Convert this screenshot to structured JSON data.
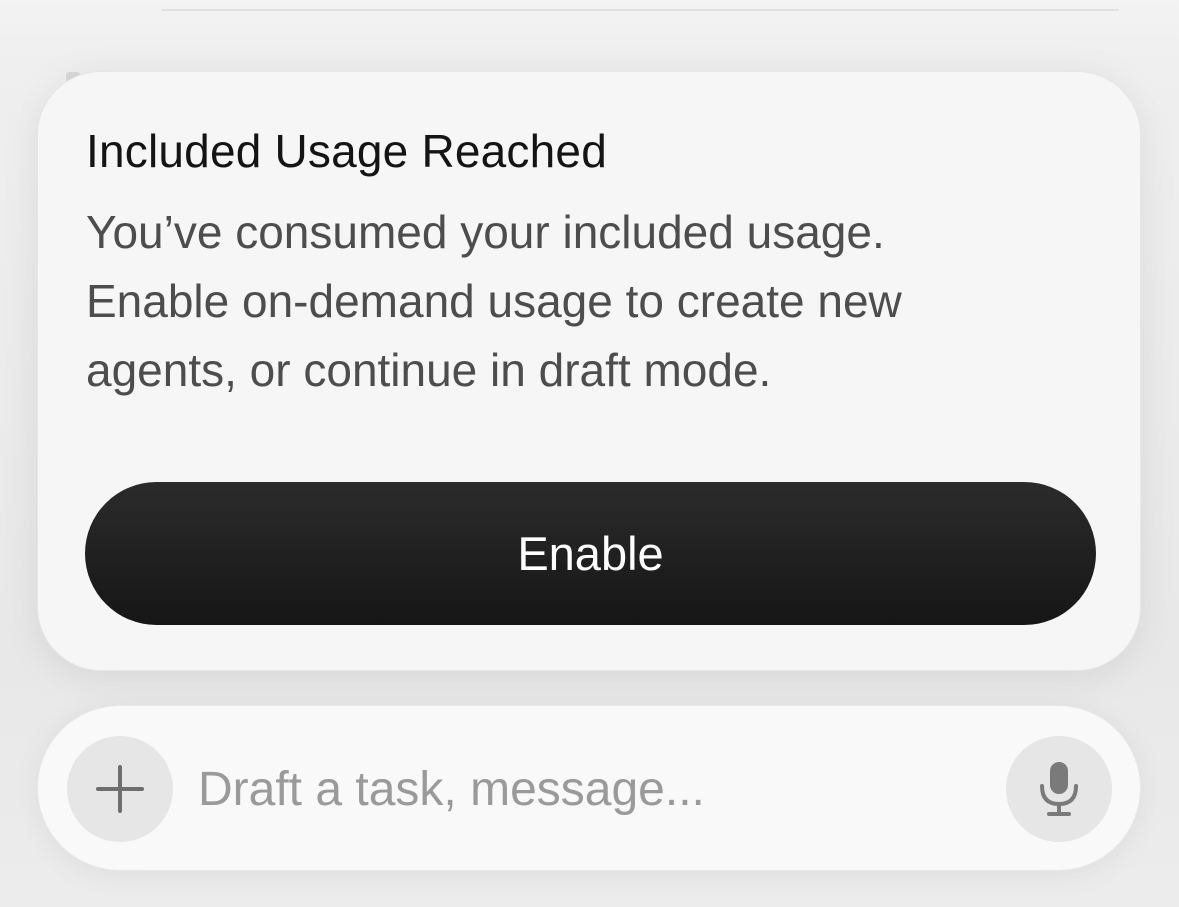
{
  "dialog": {
    "title": "Included Usage Reached",
    "body_lines": [
      "You’ve consumed your included usage.",
      "Enable on-demand usage to create new",
      "agents, or continue in draft mode."
    ],
    "enable_label": "Enable"
  },
  "composer": {
    "placeholder": "Draft a task, message...",
    "value": "",
    "attach_icon": "plus-icon",
    "voice_icon": "microphone-icon"
  },
  "colors": {
    "button_bg": "#1c1c1c",
    "button_text": "#ffffff",
    "title_text": "#141414",
    "body_text": "#4d4d4d",
    "placeholder_text": "#9a9a9a"
  }
}
